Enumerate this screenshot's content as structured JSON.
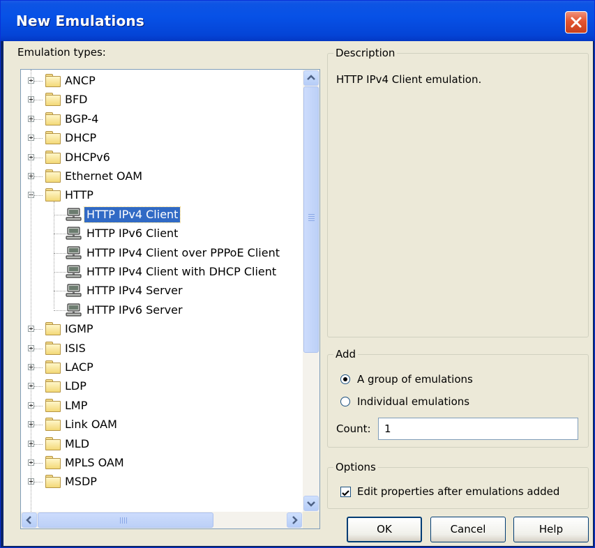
{
  "window": {
    "title": "New Emulations"
  },
  "emulation_types_label": "Emulation types:",
  "tree": {
    "items": [
      {
        "label": "ANCP",
        "kind": "folder",
        "expanded": false
      },
      {
        "label": "BFD",
        "kind": "folder",
        "expanded": false
      },
      {
        "label": "BGP-4",
        "kind": "folder",
        "expanded": false
      },
      {
        "label": "DHCP",
        "kind": "folder",
        "expanded": false
      },
      {
        "label": "DHCPv6",
        "kind": "folder",
        "expanded": false
      },
      {
        "label": "Ethernet OAM",
        "kind": "folder",
        "expanded": false
      },
      {
        "label": "HTTP",
        "kind": "folder",
        "expanded": true
      },
      {
        "label": "HTTP IPv4 Client",
        "kind": "host",
        "selected": true
      },
      {
        "label": "HTTP IPv6 Client",
        "kind": "host"
      },
      {
        "label": "HTTP IPv4 Client over PPPoE Client",
        "kind": "host"
      },
      {
        "label": "HTTP IPv4 Client with DHCP Client",
        "kind": "host"
      },
      {
        "label": "HTTP IPv4 Server",
        "kind": "host"
      },
      {
        "label": "HTTP IPv6 Server",
        "kind": "host"
      },
      {
        "label": "IGMP",
        "kind": "folder",
        "expanded": false
      },
      {
        "label": "ISIS",
        "kind": "folder",
        "expanded": false
      },
      {
        "label": "LACP",
        "kind": "folder",
        "expanded": false
      },
      {
        "label": "LDP",
        "kind": "folder",
        "expanded": false
      },
      {
        "label": "LMP",
        "kind": "folder",
        "expanded": false
      },
      {
        "label": "Link OAM",
        "kind": "folder",
        "expanded": false
      },
      {
        "label": "MLD",
        "kind": "folder",
        "expanded": false
      },
      {
        "label": "MPLS OAM",
        "kind": "folder",
        "expanded": false
      },
      {
        "label": "MSDP",
        "kind": "folder",
        "expanded": false
      }
    ]
  },
  "description": {
    "title": "Description",
    "text": "HTTP IPv4 Client emulation."
  },
  "add": {
    "title": "Add",
    "option_group": "A group of emulations",
    "option_individual": "Individual emulations",
    "selected": "group",
    "count_label": "Count:",
    "count_value": "1"
  },
  "options": {
    "title": "Options",
    "edit_after_label": "Edit properties after emulations added",
    "edit_after_checked": true
  },
  "buttons": {
    "ok": "OK",
    "cancel": "Cancel",
    "help": "Help"
  },
  "colors": {
    "titlebar": "#0751e6",
    "selection": "#316ac5",
    "dialog_bg": "#ece9d8",
    "close_button": "#e3542f"
  }
}
